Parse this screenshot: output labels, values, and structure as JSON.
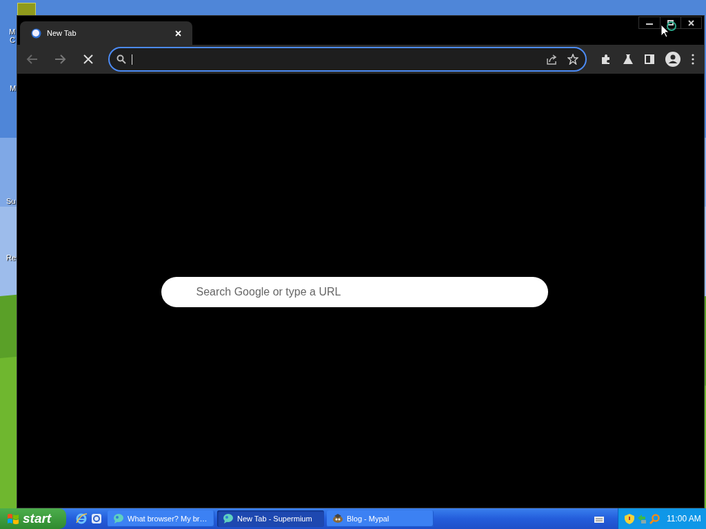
{
  "desktop": {
    "icon_labels": [
      {
        "text": "M"
      },
      {
        "text": "C"
      },
      {
        "text": "M"
      },
      {
        "text": "Su"
      },
      {
        "text": "Re"
      }
    ]
  },
  "browser": {
    "tabs": [
      {
        "title": "New Tab",
        "selected": true
      }
    ],
    "omnibox": {
      "focused": true
    },
    "new_tab_page": {
      "search_placeholder": "Search Google or type a URL"
    }
  },
  "taskbar": {
    "start_label": "start",
    "tasks": [
      {
        "label": "What browser? My br…",
        "selected": false,
        "kind": "bubble"
      },
      {
        "label": "New Tab - Supermium",
        "selected": true,
        "kind": "bubble"
      },
      {
        "label": "Blog - Mypal",
        "selected": false,
        "kind": "bird"
      }
    ],
    "clock": "11:00 AM"
  }
}
